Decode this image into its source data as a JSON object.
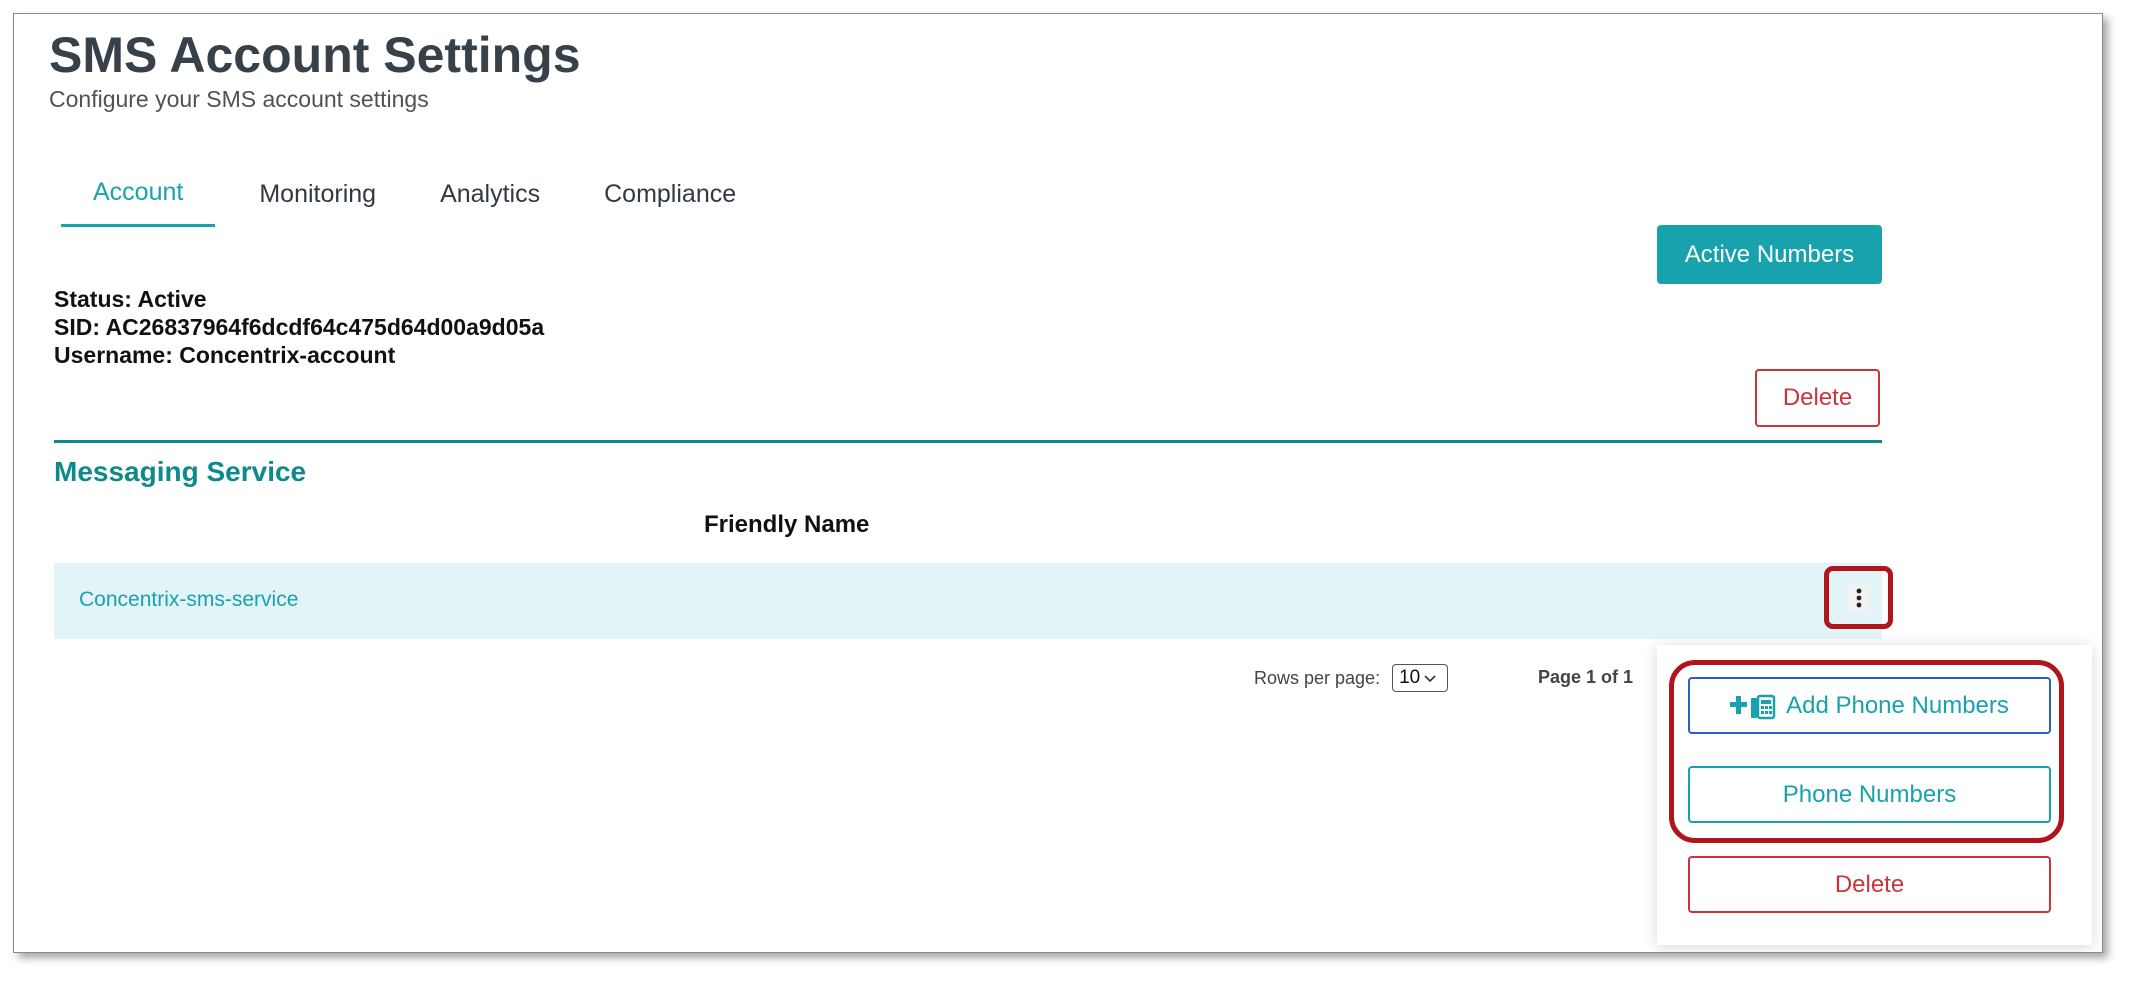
{
  "header": {
    "title": "SMS Account Settings",
    "subtitle": "Configure your SMS account settings"
  },
  "tabs": [
    {
      "label": "Account",
      "active": true
    },
    {
      "label": "Monitoring",
      "active": false
    },
    {
      "label": "Analytics",
      "active": false
    },
    {
      "label": "Compliance",
      "active": false
    }
  ],
  "actions": {
    "active_numbers_label": "Active Numbers",
    "delete_label": "Delete"
  },
  "account": {
    "status_line": "Status: Active",
    "sid_line": "SID: AC26837964f6dcdf64c475d64d00a9d05a",
    "username_line": "Username: Concentrix-account"
  },
  "messaging_service": {
    "section_title": "Messaging Service",
    "column_header": "Friendly Name",
    "rows": [
      {
        "friendly_name": "Concentrix-sms-service"
      }
    ]
  },
  "pagination": {
    "rows_per_page_label": "Rows per page:",
    "rows_per_page_value": "10",
    "page_label": "Page 1 of 1"
  },
  "row_menu": {
    "add_phone_numbers_label": "Add Phone Numbers",
    "phone_numbers_label": "Phone Numbers",
    "delete_label": "Delete"
  },
  "icons": {
    "row_menu": "more-vertical-icon",
    "add_phone": "add-phone-icon",
    "rows_select": "chevron-down-icon"
  },
  "colors": {
    "accent": "#17a2ad",
    "section": "#0e8a8a",
    "danger": "#c9353c",
    "highlight": "#b0141c",
    "row_background": "#e3f4f8",
    "title": "#37414a"
  }
}
